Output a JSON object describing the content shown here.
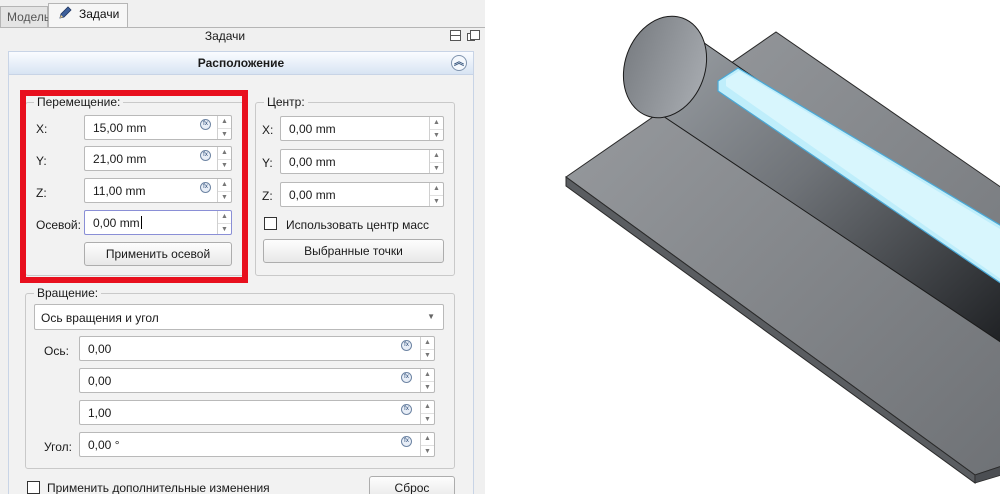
{
  "tabs": [
    {
      "label": "Модель"
    },
    {
      "label": "Задачи"
    }
  ],
  "tasks_title": "Задачи",
  "panel": {
    "title": "Расположение",
    "translation": {
      "title": "Перемещение:",
      "x_label": "X:",
      "x_value": "15,00 mm",
      "y_label": "Y:",
      "y_value": "21,00 mm",
      "z_label": "Z:",
      "z_value": "11,00 mm",
      "axial_label": "Осевой:",
      "axial_value": "0,00 mm",
      "apply_axial_label": "Применить осевой"
    },
    "center": {
      "title": "Центр:",
      "x_label": "X:",
      "x_value": "0,00 mm",
      "y_label": "Y:",
      "y_value": "0,00 mm",
      "z_label": "Z:",
      "z_value": "0,00 mm",
      "use_center_mass_label": "Использовать центр масс",
      "use_center_mass_checked": false,
      "selected_points_label": "Выбранные точки"
    },
    "rotation": {
      "title": "Вращение:",
      "mode_value": "Ось вращения и угол",
      "axis_label": "Ось:",
      "axis_x": "0,00",
      "axis_y": "0,00",
      "axis_z": "1,00",
      "angle_label": "Угол:",
      "angle_value": "0,00 °"
    },
    "apply_incremental_label": "Применить дополнительные изменения",
    "apply_incremental_checked": false,
    "reset_label": "Сброс"
  },
  "colors": {
    "highlight": "#e8101e",
    "selection": "#b9eaf8",
    "shape_gray": "#8a8d91"
  },
  "icons": {
    "formula": "fx-icon",
    "spin_up": "▲",
    "spin_down": "▼",
    "collapse": "︽",
    "dropdown": "▼"
  }
}
